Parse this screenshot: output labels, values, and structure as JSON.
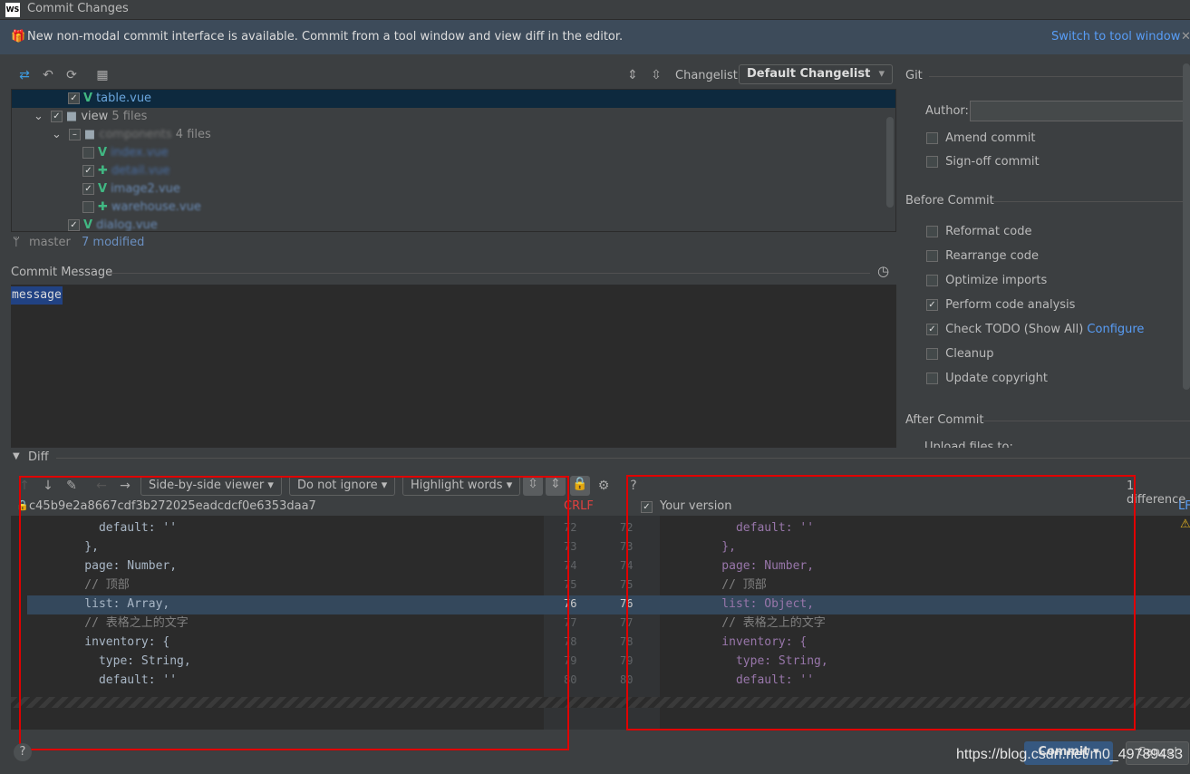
{
  "window": {
    "title": "Commit Changes",
    "logo": "WS"
  },
  "banner": {
    "text": "New non-modal commit interface is available. Commit from a tool window and view diff in the editor.",
    "link": "Switch to tool window"
  },
  "toolbar": {
    "changelist_label": "Changelist:",
    "changelist_value": "Default Changelist"
  },
  "tree": {
    "items": [
      {
        "label": "table.vue",
        "count": ""
      },
      {
        "label": "view",
        "count": "5 files"
      },
      {
        "label": "components",
        "count": "4 files"
      },
      {
        "label": "index.vue",
        "count": ""
      },
      {
        "label": "detail.vue",
        "count": ""
      },
      {
        "label": "image2.vue",
        "count": ""
      },
      {
        "label": "warehouse.vue",
        "count": ""
      },
      {
        "label": "dialog.vue",
        "count": ""
      }
    ]
  },
  "status": {
    "branch": "master",
    "modified": "7 modified"
  },
  "commit_message": {
    "label": "Commit Message",
    "value": "message"
  },
  "git": {
    "title": "Git",
    "author_label": "Author:",
    "author_value": "",
    "amend": "Amend commit",
    "signoff": "Sign-off commit"
  },
  "before_commit": {
    "title": "Before Commit",
    "options": [
      {
        "label": "Reformat code",
        "checked": false
      },
      {
        "label": "Rearrange code",
        "checked": false
      },
      {
        "label": "Optimize imports",
        "checked": false
      },
      {
        "label": "Perform code analysis",
        "checked": true
      },
      {
        "label": "Check TODO (Show All)",
        "checked": true,
        "link": "Configure"
      },
      {
        "label": "Cleanup",
        "checked": false
      },
      {
        "label": "Update copyright",
        "checked": false
      }
    ]
  },
  "after_commit": {
    "title": "After Commit",
    "upload": "Upload files to:"
  },
  "diff": {
    "title": "Diff",
    "viewer": "Side-by-side viewer",
    "ignore": "Do not ignore",
    "highlight": "Highlight words",
    "differences": "1 difference",
    "left_header": "c45b9e2a8667cdf3b272025eadcdcf0e6353daa7",
    "left_eol": "CRLF",
    "right_header": "Your version",
    "right_eol": "LF",
    "line_numbers": [
      "72",
      "73",
      "74",
      "75",
      "76",
      "77",
      "78",
      "79",
      "80"
    ],
    "left_lines": [
      "      default: ''",
      "    },",
      "    page: Number,",
      "    // 顶部",
      "    list: Array,",
      "    // 表格之上的文字",
      "    inventory: {",
      "      type: String,",
      "      default: ''"
    ],
    "right_lines": [
      "      default: ''",
      "    },",
      "    page: Number,",
      "    // 顶部",
      "    list: Object,",
      "    // 表格之上的文字",
      "    inventory: {",
      "      type: String,",
      "      default: ''"
    ]
  },
  "buttons": {
    "commit": "Commit",
    "cancel": "Cancel",
    "help": "?"
  },
  "watermark": "https://blog.csdn.net/m0_49789433"
}
